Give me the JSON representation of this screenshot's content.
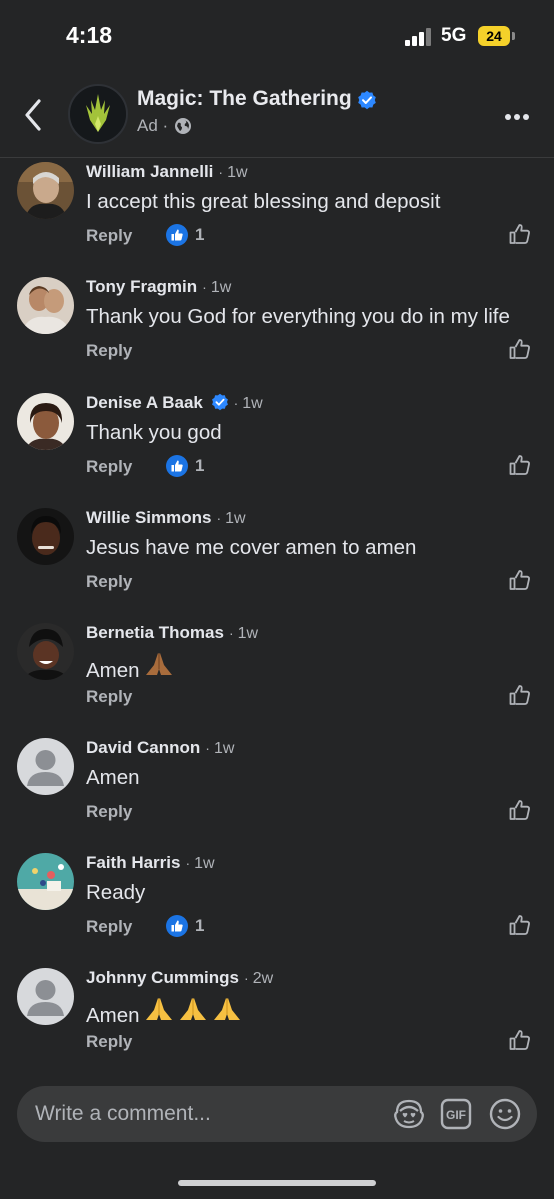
{
  "status_bar": {
    "time": "4:18",
    "network": "5G",
    "battery": "24"
  },
  "header": {
    "title": "Magic: The Gathering",
    "subtitle": "Ad ·"
  },
  "comments": [
    {
      "author": "William Jannelli",
      "age": "1w",
      "text": "I accept this great blessing and deposit",
      "reply": "Reply",
      "reactions": "1"
    },
    {
      "author": "Tony Fragmin",
      "age": "1w",
      "text": "Thank you God for everything you do in my life",
      "reply": "Reply"
    },
    {
      "author": "Denise A Baak",
      "age": "1w",
      "text": "Thank you god",
      "reply": "Reply",
      "reactions": "1"
    },
    {
      "author": "Willie Simmons",
      "age": "1w",
      "text": "Jesus have me cover amen to amen",
      "reply": "Reply"
    },
    {
      "author": "Bernetia Thomas",
      "age": "1w",
      "text": "Amen",
      "reply": "Reply"
    },
    {
      "author": "David Cannon",
      "age": "1w",
      "text": "Amen",
      "reply": "Reply"
    },
    {
      "author": "Faith Harris",
      "age": "1w",
      "text": "Ready",
      "reply": "Reply",
      "reactions": "1"
    },
    {
      "author": "Johnny Cummings",
      "age": "2w",
      "text": "Amen",
      "reply": "Reply"
    }
  ],
  "composer": {
    "placeholder": "Write a comment..."
  },
  "icons": [
    "back-chevron-icon",
    "verified-badge-icon",
    "globe-icon",
    "more-icon",
    "thumbs-up-icon",
    "like-reaction-icon",
    "avatar-sticker-icon",
    "gif-icon",
    "emoji-icon"
  ],
  "colors": {
    "background": "#242526",
    "accent": "#1b74e4",
    "verified": "#2d88ff",
    "battery": "#f5d12a"
  }
}
